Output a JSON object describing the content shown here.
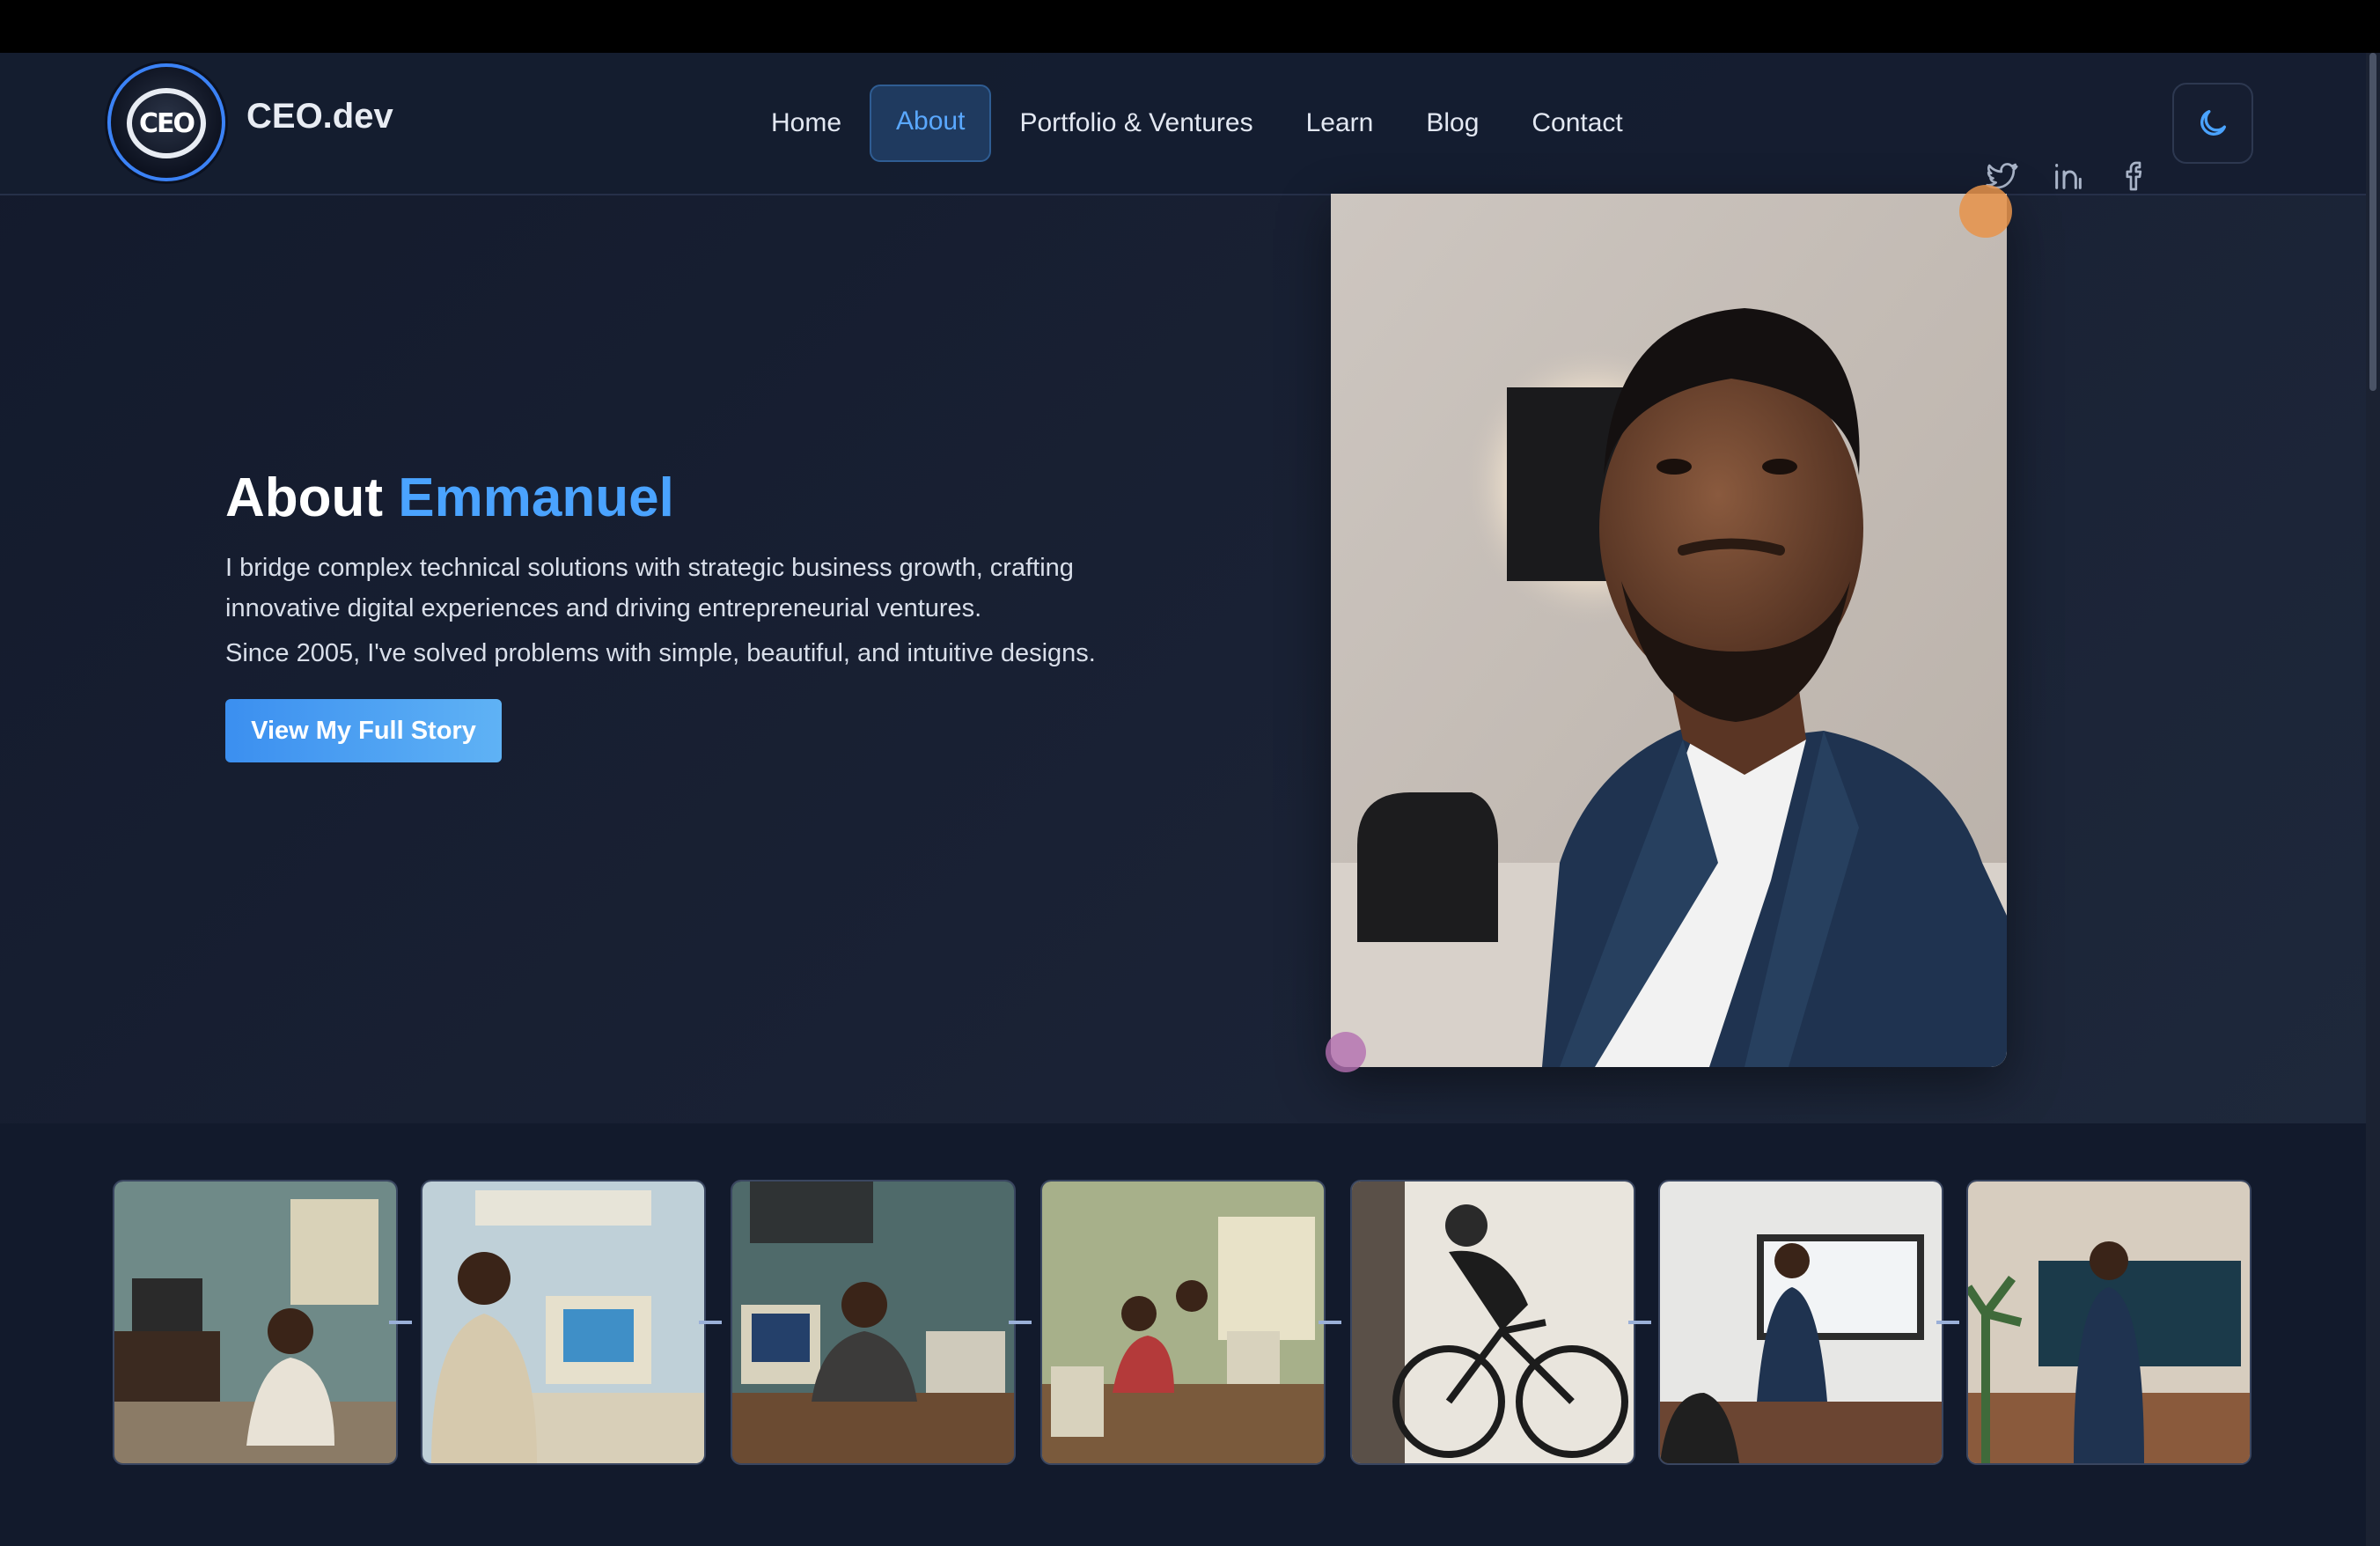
{
  "brand": {
    "name": "CEO.dev",
    "logo_text": "CEO",
    "logo_icon": "ceo-shield-logo"
  },
  "nav": {
    "links": [
      {
        "label": "Home",
        "active": false
      },
      {
        "label": "About",
        "active": true
      },
      {
        "label": "Portfolio & Ventures",
        "active": false
      },
      {
        "label": "Learn",
        "active": false
      },
      {
        "label": "Blog",
        "active": false
      },
      {
        "label": "Contact",
        "active": false
      }
    ],
    "social_icons": [
      "twitter-icon",
      "linkedin-icon",
      "facebook-icon"
    ],
    "theme_toggle_icon": "moon-icon"
  },
  "hero": {
    "title_prefix": "About",
    "title_accent": "Emmanuel",
    "paragraph1": "I bridge complex technical solutions with strategic business growth, crafting innovative digital experiences and driving entrepreneurial ventures.",
    "paragraph2": "Since 2005, I've solved problems with simple, beautiful, and intuitive designs.",
    "cta_label": "View My Full Story"
  },
  "colors": {
    "accent": "#4aa3ff",
    "nav_active_bg": "#1f3a5f",
    "background": "#141b2e",
    "button_gradient_start": "#3b8ff0",
    "button_gradient_end": "#5fb2f5",
    "orb_orange": "#e8934a",
    "orb_pink": "#b46fb0"
  },
  "gallery": {
    "images": [
      "child-with-crt-tv-photo",
      "teen-computer-lab-photo",
      "young-man-at-computer-photo",
      "group-computer-class-photo",
      "cyclist-training-photo",
      "business-presentation-photo",
      "ceo-office-portrait-photo"
    ]
  }
}
